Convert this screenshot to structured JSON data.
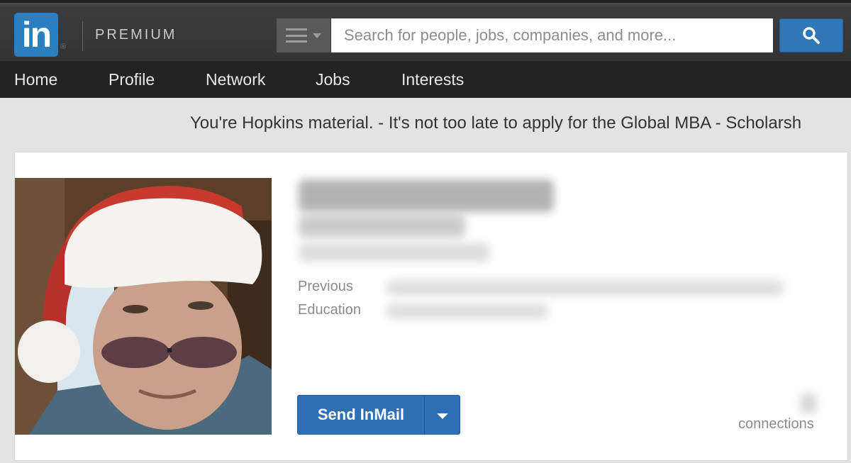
{
  "header": {
    "logo_text": "in",
    "logo_reg": "®",
    "brand_label": "PREMIUM",
    "search": {
      "placeholder": "Search for people, jobs, companies, and more..."
    }
  },
  "nav": {
    "items": [
      "Home",
      "Profile",
      "Network",
      "Jobs",
      "Interests"
    ]
  },
  "ad": {
    "text": "You're Hopkins material. - It's not too late to apply for the Global MBA - Scholarsh"
  },
  "profile": {
    "fields": [
      {
        "label": "Previous"
      },
      {
        "label": "Education"
      }
    ],
    "send_button_label": "Send InMail",
    "connections_label": "connections"
  },
  "colors": {
    "brand_blue": "#2a7fc0",
    "button_blue": "#2f6fb4",
    "topbar": "#333333",
    "navbar": "#232323"
  }
}
